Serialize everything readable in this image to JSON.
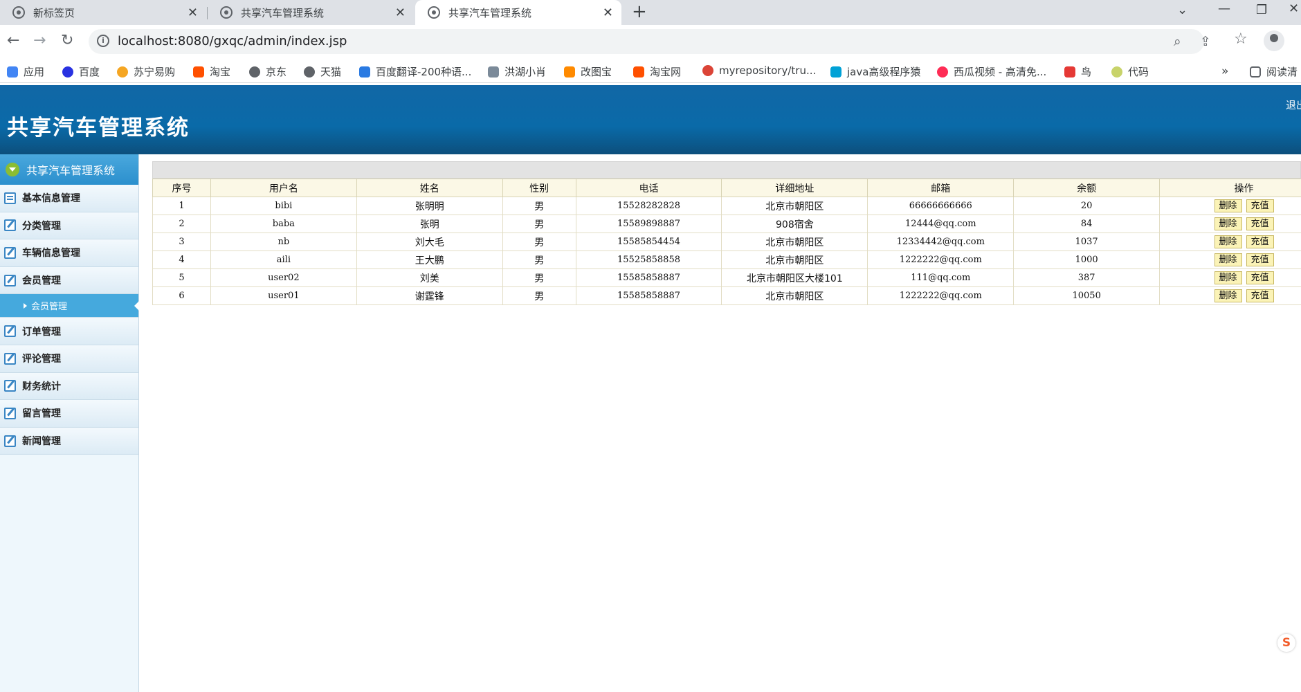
{
  "browser": {
    "tabs": [
      {
        "title": "新标签页",
        "active": false
      },
      {
        "title": "共享汽车管理系统",
        "active": false
      },
      {
        "title": "共享汽车管理系统",
        "active": true
      }
    ],
    "url": "localhost:8080/gxqc/admin/index.jsp",
    "bookmarks": [
      {
        "label": "应用",
        "color": "#4285f4"
      },
      {
        "label": "百度",
        "color": "#2932e1"
      },
      {
        "label": "苏宁易购",
        "color": "#f5a623"
      },
      {
        "label": "淘宝",
        "color": "#ff5000"
      },
      {
        "label": "京东",
        "color": "#5f6368"
      },
      {
        "label": "天猫",
        "color": "#5f6368"
      },
      {
        "label": "百度翻译-200种语...",
        "color": "#2a7ae2"
      },
      {
        "label": "洪湖小肖",
        "color": "#7b8a99"
      },
      {
        "label": "改图宝",
        "color": "#ff8a00"
      },
      {
        "label": "淘宝网",
        "color": "#ff5000"
      },
      {
        "label": "myrepository/tru...",
        "color": "#db4437"
      },
      {
        "label": "java高级程序猿",
        "color": "#00a1d6"
      },
      {
        "label": "西瓜视频 - 高清免...",
        "color": "#fe2c55"
      },
      {
        "label": "鸟",
        "color": "#e53935"
      },
      {
        "label": "代码",
        "color": "#c8d36a"
      }
    ],
    "more_label": "»",
    "reading_list": "阅读清"
  },
  "app": {
    "title": "共享汽车管理系统",
    "logout": "退出"
  },
  "sidebar": {
    "header": "共享汽车管理系统",
    "items": [
      {
        "label": "基本信息管理"
      },
      {
        "label": "分类管理"
      },
      {
        "label": "车辆信息管理"
      },
      {
        "label": "会员管理"
      }
    ],
    "sub_item": "会员管理",
    "items_after": [
      {
        "label": "订单管理"
      },
      {
        "label": "评论管理"
      },
      {
        "label": "财务统计"
      },
      {
        "label": "留言管理"
      },
      {
        "label": "新闻管理"
      }
    ]
  },
  "table": {
    "headers": [
      "序号",
      "用户名",
      "姓名",
      "性别",
      "电话",
      "详细地址",
      "邮箱",
      "余额",
      "操作"
    ],
    "rows": [
      [
        "1",
        "bibi",
        "张明明",
        "男",
        "15528282828",
        "北京市朝阳区",
        "66666666666",
        "20"
      ],
      [
        "2",
        "baba",
        "张明",
        "男",
        "15589898887",
        "908宿舍",
        "12444@qq.com",
        "84"
      ],
      [
        "3",
        "nb",
        "刘大毛",
        "男",
        "15585854454",
        "北京市朝阳区",
        "12334442@qq.com",
        "1037"
      ],
      [
        "4",
        "aili",
        "王大鹏",
        "男",
        "15525858858",
        "北京市朝阳区",
        "1222222@qq.com",
        "1000"
      ],
      [
        "5",
        "user02",
        "刘美",
        "男",
        "15585858887",
        "北京市朝阳区大楼101",
        "111@qq.com",
        "387"
      ],
      [
        "6",
        "user01",
        "谢霆锋",
        "男",
        "15585858887",
        "北京市朝阳区",
        "1222222@qq.com",
        "10050"
      ]
    ],
    "delete_label": "删除",
    "recharge_label": "充值"
  }
}
